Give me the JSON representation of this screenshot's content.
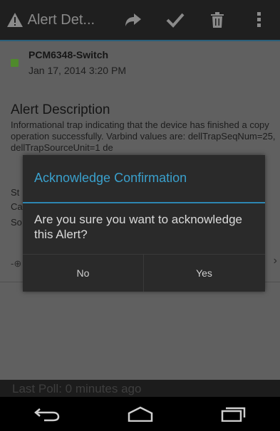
{
  "action_bar": {
    "title": "Alert Det...",
    "icons": [
      "warning-icon",
      "forward-icon",
      "check-icon",
      "delete-icon",
      "overflow-menu-icon"
    ]
  },
  "alert": {
    "device": "PCM6348-Switch",
    "datetime": "Jan 17, 2014 3:20 PM",
    "checked": true,
    "description_title": "Alert Description",
    "description_text": "Informational trap indicating that the device has finished a copy operation successfully. Varbind values are: dellTrapSeqNum=25, dellTrapSourceUnit=1 de",
    "label_st": "St",
    "label_ca": "Ca",
    "label_so": "So"
  },
  "dialog": {
    "title": "Acknowledge Confirmation",
    "message": "Are you sure you want to acknowledge this Alert?",
    "no_label": "No",
    "yes_label": "Yes"
  },
  "status": {
    "last_poll": "Last Poll: 0 minutes ago"
  },
  "colors": {
    "accent": "#3aa0cc",
    "checkbox": "#4f8a2c"
  }
}
